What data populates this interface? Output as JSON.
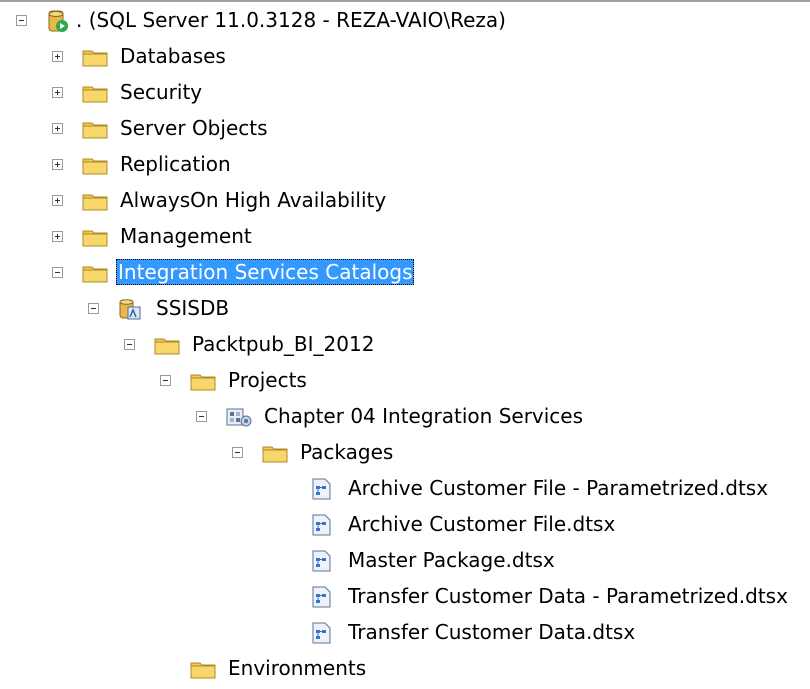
{
  "tree": {
    "server": ". (SQL Server 11.0.3128 - REZA-VAIO\\Reza)",
    "databases": "Databases",
    "security": "Security",
    "server_objects": "Server Objects",
    "replication": "Replication",
    "alwayson": "AlwaysOn High Availability",
    "management": "Management",
    "is_catalogs": "Integration Services Catalogs",
    "ssisdb": "SSISDB",
    "folder": "Packtpub_BI_2012",
    "projects": "Projects",
    "project": "Chapter 04 Integration Services",
    "packages": "Packages",
    "package_items": [
      "Archive Customer File - Parametrized.dtsx",
      "Archive Customer File.dtsx",
      "Master Package.dtsx",
      "Transfer Customer Data - Parametrized.dtsx",
      "Transfer Customer Data.dtsx"
    ],
    "environments": "Environments"
  },
  "colors": {
    "selection": "#3399ff",
    "folder": "#f2c84b"
  }
}
